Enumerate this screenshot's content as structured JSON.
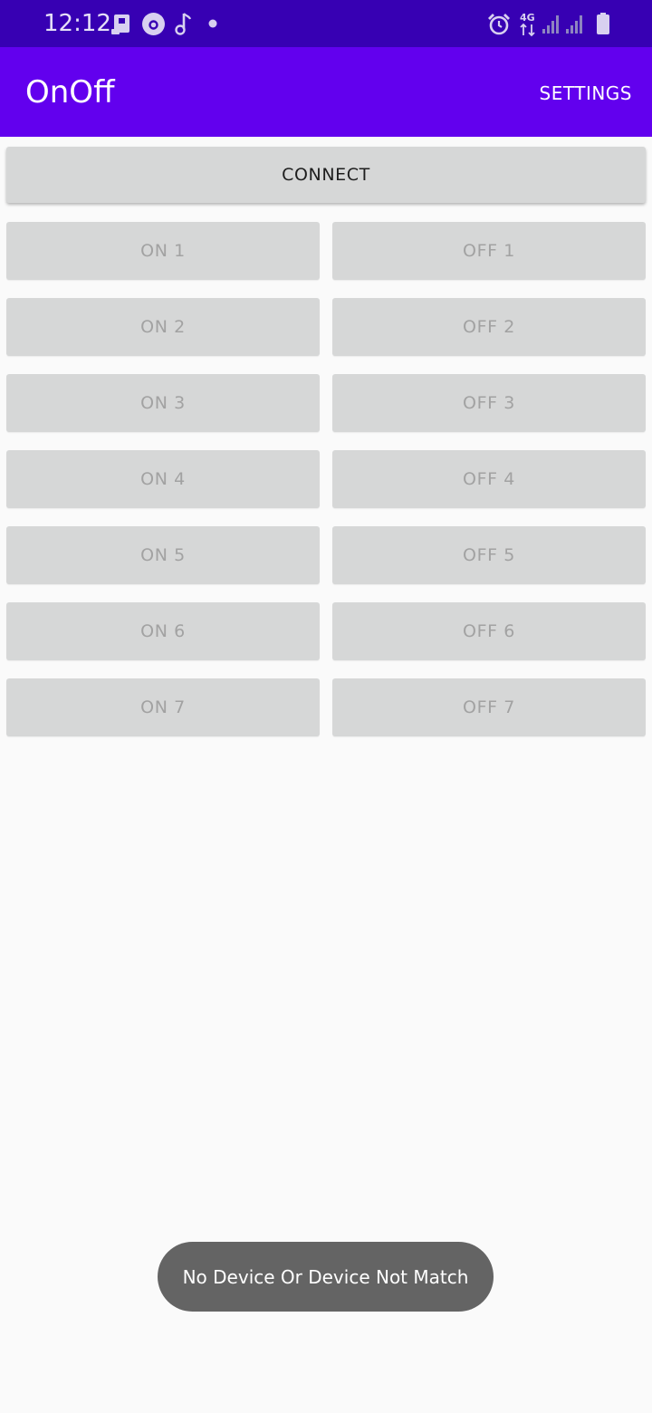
{
  "status_bar": {
    "time": "12:12",
    "network_label": "4G",
    "icons": [
      "screen-cast-icon",
      "notification-badge-icon",
      "music-note-icon",
      "dot-icon",
      "alarm-icon",
      "network-4g-icon",
      "signal-icon",
      "signal-icon",
      "battery-icon"
    ],
    "color": "#3700b3"
  },
  "app_bar": {
    "title": "OnOff",
    "settings_label": "SETTINGS",
    "color": "#6200ee"
  },
  "main": {
    "connect_label": "CONNECT",
    "on_buttons": [
      "ON 1",
      "ON 2",
      "ON 3",
      "ON 4",
      "ON 5",
      "ON 6",
      "ON 7"
    ],
    "off_buttons": [
      "OFF 1",
      "OFF 2",
      "OFF 3",
      "OFF 4",
      "OFF 5",
      "OFF 6",
      "OFF 7"
    ]
  },
  "toast": {
    "message": "No Device Or Device Not Match"
  }
}
